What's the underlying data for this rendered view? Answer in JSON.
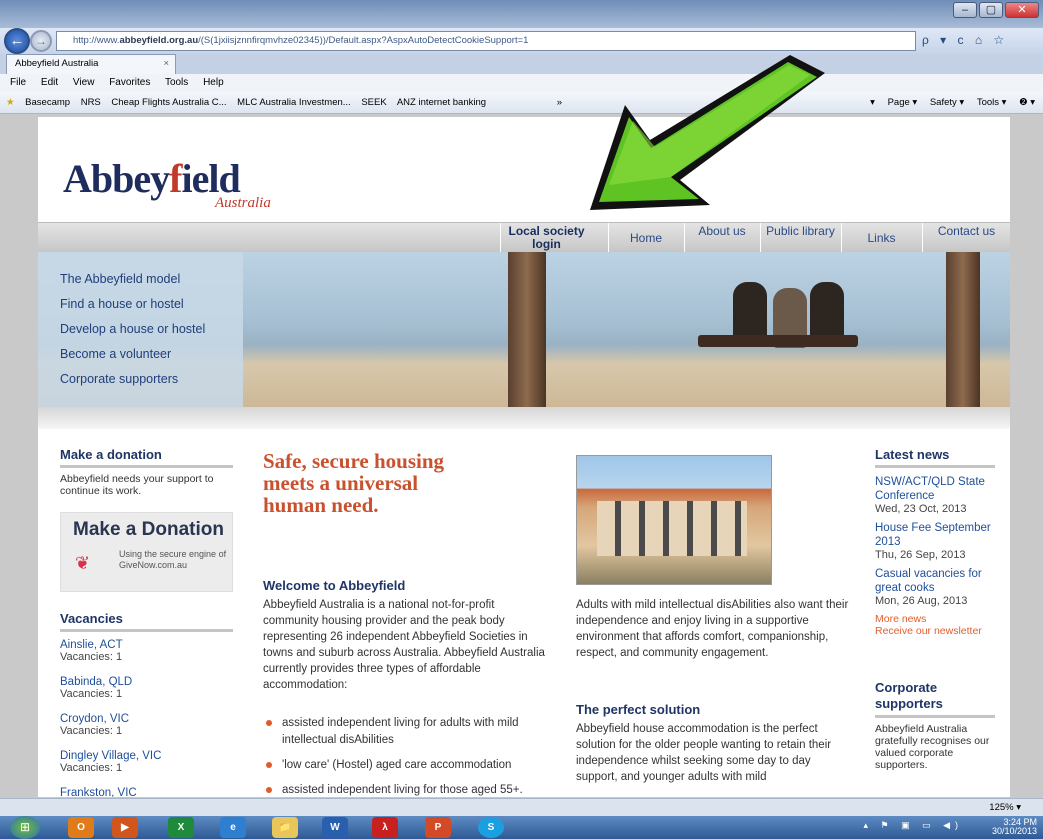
{
  "browser": {
    "url_prefix": "http://www.",
    "url_domain": "abbeyfield.org.au",
    "url_rest": "/(S(1jxiisjznnfirqmvhze02345))/Default.aspx?AspxAutoDetectCookieSupport=1",
    "address_tools": "ρ ▾ c  ⌂ ☆",
    "tab_title": "Abbeyfield Australia",
    "tab_close": "×",
    "menu": [
      "File",
      "Edit",
      "View",
      "Favorites",
      "Tools",
      "Help"
    ],
    "favorites": [
      "Basecamp",
      "NRS",
      "Cheap Flights Australia C...",
      "MLC Australia Investmen...",
      "SEEK",
      "ANZ internet banking"
    ],
    "favorites_more": "»",
    "command_bar": [
      "▾",
      "Page ▾",
      "Safety ▾",
      "Tools ▾",
      "❷ ▾"
    ],
    "zoom": "125% ▾"
  },
  "site": {
    "logo_text": "Abbey",
    "logo_f": "f",
    "logo_rest": "ield",
    "logo_sub": "Australia",
    "nav": [
      {
        "label": "Local society login"
      },
      {
        "label": "Home"
      },
      {
        "label": "About us"
      },
      {
        "label": "Public library"
      },
      {
        "label": "Links"
      },
      {
        "label": "Contact us"
      }
    ],
    "side_menu": [
      "The Abbeyfield model",
      "Find a house or hostel",
      "Develop a house or hostel",
      "Become a volunteer",
      "Corporate supporters"
    ]
  },
  "donation": {
    "heading": "Make a donation",
    "text": "Abbeyfield needs your support to continue its work.",
    "box_title": "Make a Donation",
    "box_sub": "Using the secure engine of GiveNow.com.au"
  },
  "vacancies": {
    "heading": "Vacancies",
    "items": [
      {
        "place": "Ainslie, ACT",
        "count": "Vacancies: 1"
      },
      {
        "place": "Babinda, QLD",
        "count": "Vacancies: 1"
      },
      {
        "place": "Croydon, VIC",
        "count": "Vacancies: 1"
      },
      {
        "place": "Dingley Village, VIC",
        "count": "Vacancies: 1"
      },
      {
        "place": "Frankston, VIC",
        "count": ""
      }
    ]
  },
  "main": {
    "headline": "Safe, secure housing meets a universal human need.",
    "welcome_heading": "Welcome to Abbeyfield",
    "welcome_text": "Abbeyfield Australia is a national not-for-profit community housing provider and the peak body representing 26 independent Abbeyfield Societies in towns and suburb across Australia. Abbeyfield Australia currently provides three types of affordable accommodation:",
    "bullets": [
      "assisted independent living for adults with mild intellectual disAbilities",
      "'low care' (Hostel) aged care accommodation",
      "assisted independent living for those aged 55+."
    ],
    "right_text": "Adults with mild intellectual disAbilities also want their independence and enjoy living in a supportive environment that affords comfort, companionship, respect, and community engagement.",
    "solution_heading": "The perfect solution",
    "solution_text": "Abbeyfield house accommodation is the perfect solution for the older people wanting to retain their independence whilst seeking some day to day support, and younger adults with mild"
  },
  "news": {
    "heading": "Latest news",
    "items": [
      {
        "title": "NSW/ACT/QLD State Conference",
        "date": "Wed, 23 Oct, 2013"
      },
      {
        "title": "House Fee September 2013",
        "date": "Thu, 26 Sep, 2013"
      },
      {
        "title": "Casual vacancies for great cooks",
        "date": "Mon, 26 Aug, 2013"
      }
    ],
    "more": "More news",
    "newsletter": "Receive our newsletter"
  },
  "corporate": {
    "heading": "Corporate supporters",
    "text": "Abbeyfield Australia gratefully recognises our valued corporate supporters."
  },
  "taskbar": {
    "apps": [
      "O",
      "▶",
      "X",
      "e",
      "📁",
      "W",
      "λ",
      "P",
      "S"
    ],
    "time": "3:24 PM",
    "date": "30/10/2013"
  },
  "colors": {
    "brand_navy": "#1f2d5e",
    "brand_orange": "#c9512d",
    "arrow_green": "#4fb81c"
  }
}
